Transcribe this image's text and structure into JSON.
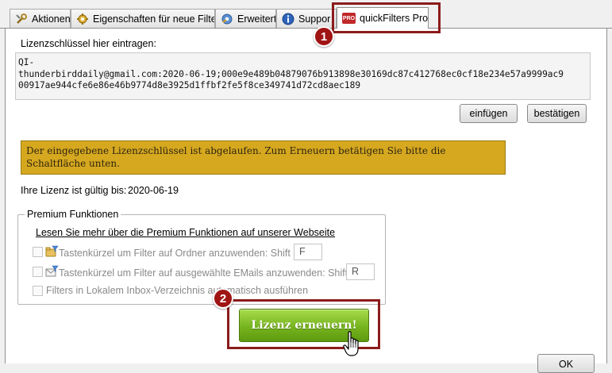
{
  "tabs": [
    {
      "label": "Aktionen",
      "icon": "tools-icon"
    },
    {
      "label": "Eigenschaften für neue Filter",
      "icon": "gear-icon"
    },
    {
      "label": "Erweitert",
      "icon": "advanced-gear-icon"
    },
    {
      "label": "Suppor",
      "icon": "info-icon"
    },
    {
      "label": "quickFilters Pro",
      "icon": "pro-badge-icon",
      "badge": "PRO",
      "active": true
    }
  ],
  "license": {
    "prompt_label": "Lizenzschlüssel hier eintragen:",
    "key_lines": [
      "QI-",
      "thunderbirddaily@gmail.com:2020-06-19;000e9e489b04879076b913898e30169dc87c412768ec0cf18e234e57a9999ac9",
      "00917ae944cfe6e86e46b9774d8e3925d1ffbf2fe5f8ce349741d72cd8aec189"
    ],
    "paste_button": "einfügen",
    "confirm_button": "bestätigen",
    "warning": "Der eingegebene Lizenzschlüssel ist abgelaufen. Zum Erneuern betätigen Sie bitte die Schaltfläche unten.",
    "valid_label": "Ihre Lizenz ist gültig bis:",
    "valid_date": "2020-06-19"
  },
  "premium": {
    "legend": "Premium Funktionen",
    "link": "Lesen Sie mehr über die Premium Funktionen auf unserer Webseite",
    "option1": {
      "label": "Tastenkürzel um Filter auf Ordner anzuwenden: Shift +",
      "value": "F"
    },
    "option2": {
      "label": "Tastenkürzel um Filter auf ausgewählte EMails anzuwenden: Shift +",
      "value": "R"
    },
    "option3": {
      "label": "Filters in Lokalem Inbox-Verzeichnis automatisch ausführen"
    }
  },
  "renew_button": "Lizenz erneuern!",
  "ok_button": "OK",
  "markers": [
    "1",
    "2"
  ],
  "colors": {
    "marker": "#a01414",
    "highlight_border": "#8b1b1b",
    "warning_bg": "#d6a820",
    "renew_green": "#76b41e",
    "pro_badge": "#c0282a"
  }
}
